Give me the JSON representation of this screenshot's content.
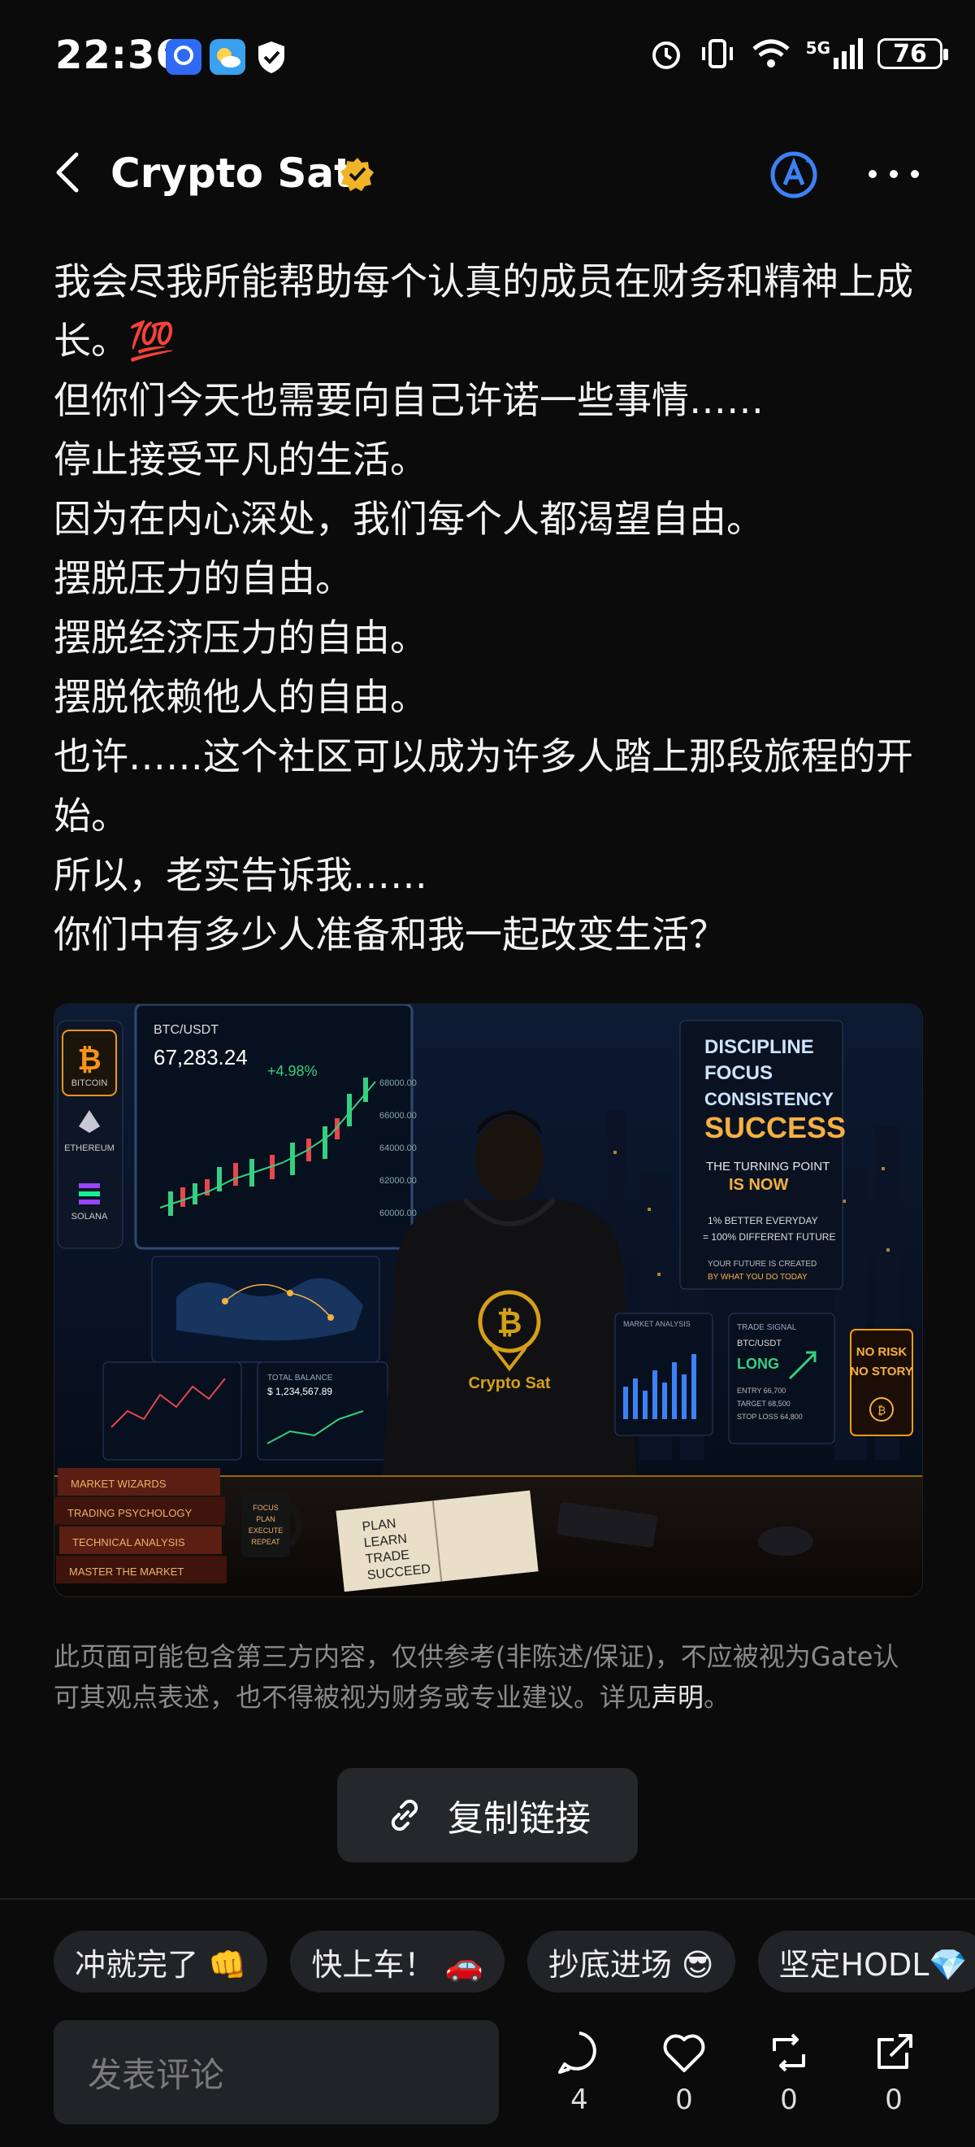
{
  "status_bar": {
    "time": "22:36",
    "network": "5G",
    "battery": "76"
  },
  "header": {
    "title": "Crypto Sat",
    "verified_icon": "verified-badge-icon",
    "translate_icon": "translate-icon",
    "more_icon": "more-icon"
  },
  "post": {
    "lines": [
      "我会尽我所能帮助每个认真的成员在财务和精神上成长。💯",
      "但你们今天也需要向自己许诺一些事情……",
      "停止接受平凡的生活。",
      "因为在内心深处，我们每个人都渴望自由。",
      "摆脱压力的自由。",
      "摆脱经济压力的自由。",
      "摆脱依赖他人的自由。",
      "也许……这个社区可以成为许多人踏上那段旅程的开始。",
      "所以，老实告诉我……",
      "你们中有多少人准备和我一起改变生活？"
    ]
  },
  "image": {
    "pair": "BTC/USDT",
    "price": "67,283.24",
    "change": "+4.98%",
    "coins": [
      "BITCOIN",
      "ETHEREUM",
      "SOLANA"
    ],
    "board": [
      "DISCIPLINE",
      "FOCUS",
      "CONSISTENCY",
      "SUCCESS"
    ],
    "turning1": "THE TURNING POINT",
    "turning2": "IS NOW",
    "better1": "1% BETTER EVERYDAY",
    "better2": "= 100% DIFFERENT FUTURE",
    "future1": "YOUR FUTURE IS CREATED",
    "future2": "BY WHAT YOU DO TODAY",
    "brand": "Crypto Sat",
    "norisk1": "NO RISK",
    "norisk2": "NO STORY",
    "signal_title": "TRADE SIGNAL",
    "signal_pair": "BTC/USDT",
    "signal_side": "LONG",
    "signal_rows": [
      "ENTRY 66,700",
      "TARGET 68,500",
      "STOP LOSS 64,800"
    ],
    "balance_label": "TOTAL BALANCE",
    "balance": "$ 1,234,567.89",
    "market_label": "MARKET ANALYSIS",
    "books": [
      "MARKET WIZARDS",
      "TRADING PSYCHOLOGY",
      "TECHNICAL ANALYSIS",
      "MASTER THE MARKET"
    ],
    "notebook": [
      "PLAN",
      "LEARN",
      "TRADE",
      "SUCCEED"
    ],
    "mug": [
      "FOCUS",
      "PLAN",
      "EXECUTE",
      "REPEAT"
    ]
  },
  "disclaimer": {
    "text": "此页面可能包含第三方内容，仅供参考(非陈述/保证)，不应被视为Gate认可其观点表述，也不得被视为财务或专业建议。详见",
    "link": "声明",
    "end": "。"
  },
  "copy_button": {
    "label": "复制链接"
  },
  "chips": [
    "冲就完了 👊",
    "快上车！ 🚗",
    "抄底进场 😎",
    "坚定HODL💎"
  ],
  "comment": {
    "placeholder": "发表评论"
  },
  "actions": {
    "comments": "4",
    "likes": "0",
    "reposts": "0",
    "shares": "0"
  },
  "colors": {
    "background": "#0b0b0c",
    "accent_gold": "#f0b429",
    "translate_blue": "#3b82f6",
    "chip_bg": "#222327"
  }
}
